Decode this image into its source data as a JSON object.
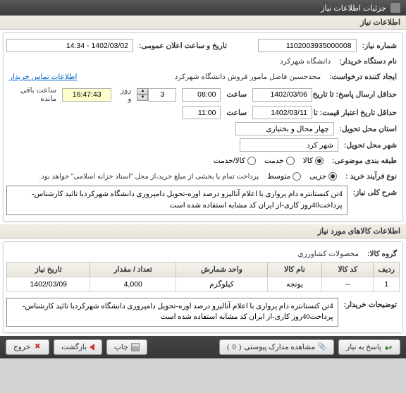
{
  "titlebar": {
    "title": "جزئیات اطلاعات نیاز"
  },
  "section1": {
    "header": "اطلاعات نیاز",
    "lbl_need_no": "شماره نیاز:",
    "need_no": "1102003935000008",
    "lbl_pub_date": "تاریخ و ساعت اعلان عمومی:",
    "pub_date": "1402/03/02 - 14:34",
    "lbl_buyer": "نام دستگاه خریدار:",
    "buyer": "دانشگاه شهرکرد",
    "lbl_requester": "ایجاد کننده درخواست:",
    "requester": "مجدحسین فاضل مامور فروش دانشگاه شهرکرد",
    "lbl_contact": "اطلاعات تماس خریدار",
    "lbl_reply_deadline": "حداقل ارسال پاسخ: تا تاریخ:",
    "reply_date": "1402/03/06",
    "lbl_hour": "ساعت",
    "reply_time": "08:00",
    "lbl_days": "روز و",
    "days_left": "3",
    "remain_time": "16:47:43",
    "remain_label": "ساعت باقی مانده",
    "lbl_validity": "حداقل تاریخ اعتبار قیمت: تا تاریخ:",
    "validity_date": "1402/03/11",
    "validity_time": "11:00",
    "lbl_request_place": "استان محل تحویل:",
    "request_place": "چهار محال و بختیاری",
    "lbl_delivery_place": "شهر محل تحویل:",
    "delivery_place": "شهر کرد",
    "lbl_subject_class": "طبقه بندی موضوعی:",
    "lbl_process_type": "نوع فرآیند خرید :",
    "radio_goods": "کالا",
    "radio_service": "خدمت",
    "radio_goods_service": "کالا/خدمت",
    "radio_minor": "جزیی",
    "radio_medium": "متوسط",
    "payment_note": "پرداخت تمام یا بخشی از مبلغ خرید،از محل \"اسناد خزانه اسلامی\" خواهد بود.",
    "lbl_need_desc": "شرح کلی نیاز:",
    "need_desc": "4تن کنستانتره دام پرواری با اعلام آنالیزو درصد اوره-تحویل دامپروری دانشگاه شهرکردبا تائید کارشناس-پرداخت40روز کاری-از ایران کد مشابه استفاده شده است"
  },
  "section2": {
    "header": "اطلاعات کالاهای مورد نیاز",
    "lbl_group": "گروه کالا:",
    "group": "محصولات کشاورزی",
    "table": {
      "headers": [
        "ردیف",
        "کد کالا",
        "نام کالا",
        "واحد شمارش",
        "تعداد / مقدار",
        "تاریخ نیاز"
      ],
      "rows": [
        {
          "redif": "1",
          "code": "--",
          "name": "یونجه",
          "unit": "کیلوگرم",
          "qty": "4,000",
          "date": "1402/03/09"
        }
      ]
    },
    "lbl_buyer_notes": "توضیحات خریدار:",
    "buyer_notes": "4تن کنستانتره دام پرواری با اعلام آنالیزو درصد اوره-تحویل دامپروری دانشگاه شهرکردبا تائید کارشناس-پرداخت40روز کاری-از ایران کد مشابه استفاده شده است"
  },
  "footer": {
    "reply_btn": "پاسخ به نیاز",
    "view_attach": "مشاهده مدارک پیوستی",
    "attach_count": "0",
    "print": "چاپ",
    "back": "بازگشت",
    "exit": "خروج"
  }
}
